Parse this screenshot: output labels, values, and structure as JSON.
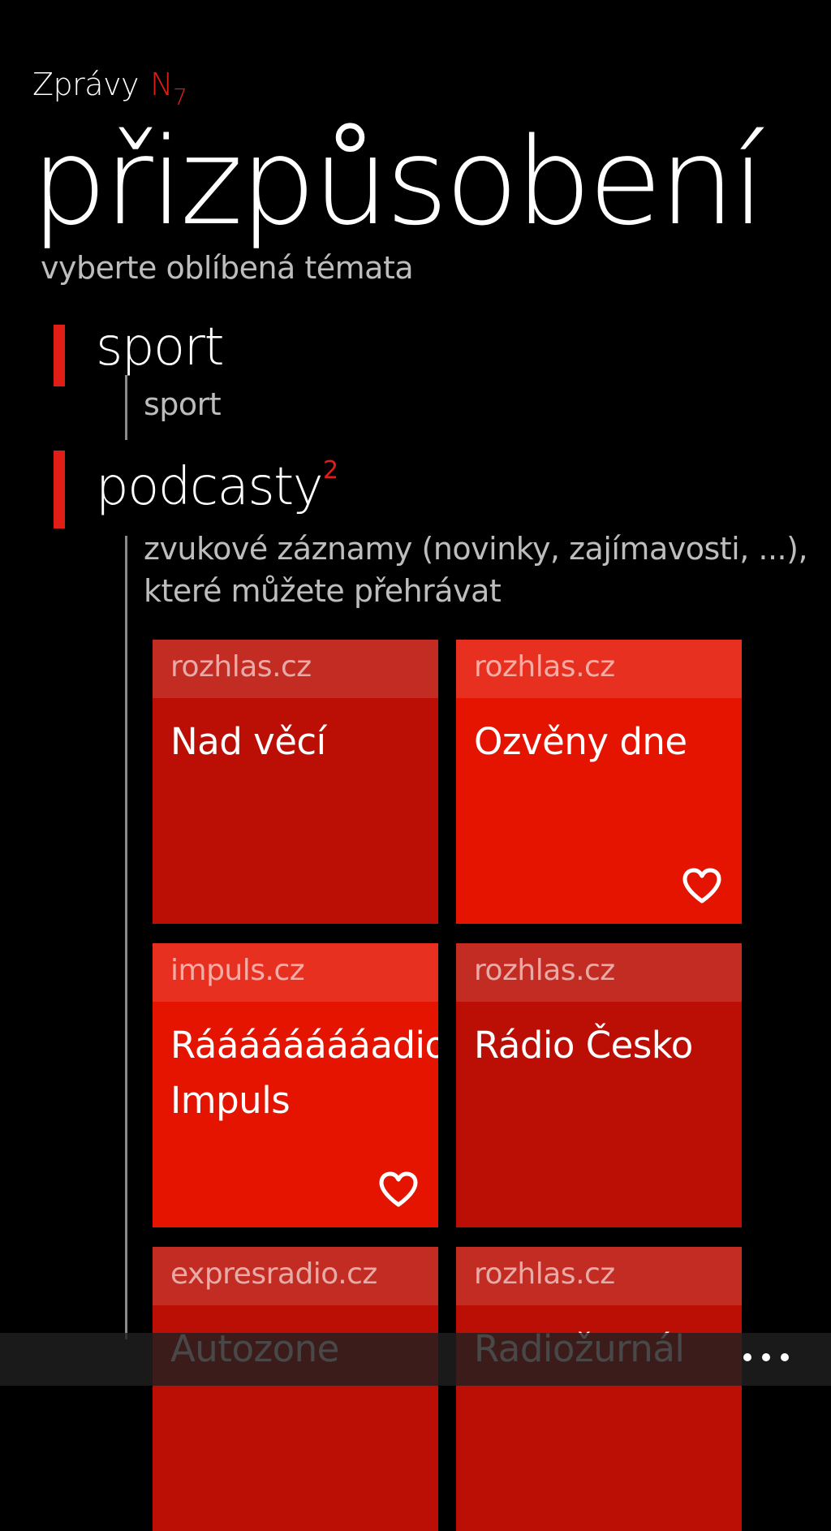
{
  "header": {
    "app_name": "Zprávy",
    "logo_letter": "N",
    "logo_number": "7"
  },
  "page": {
    "title": "přizpůsobení",
    "subtitle": "vyberte oblíbená témata"
  },
  "categories": [
    {
      "title": "sport",
      "description": "sport"
    },
    {
      "title": "podcasty",
      "count": "2",
      "description_line1": "zvukové záznamy (novinky, zajímavosti, ...),",
      "description_line2": "které můžete přehrávat"
    }
  ],
  "tiles": [
    {
      "source": "rozhlas.cz",
      "name": "Nad věcí",
      "favorited": false
    },
    {
      "source": "rozhlas.cz",
      "name": "Ozvěny dne",
      "favorited": true
    },
    {
      "source": "impuls.cz",
      "name_line1": "Rááááááááadio",
      "name_line2": "Impuls",
      "favorited": true
    },
    {
      "source": "rozhlas.cz",
      "name": "Rádio Česko",
      "favorited": false
    },
    {
      "source": "expresradio.cz",
      "name": "Autozone",
      "favorited": false
    },
    {
      "source": "rozhlas.cz",
      "name": "Radiožurnál",
      "favorited": false
    }
  ],
  "colors": {
    "accent": "#e01e16",
    "tile_dark": "#bb0f05",
    "tile_bright": "#e41400"
  },
  "icons": {
    "favorite": "heart-outline-icon",
    "more": "ellipsis-icon"
  }
}
